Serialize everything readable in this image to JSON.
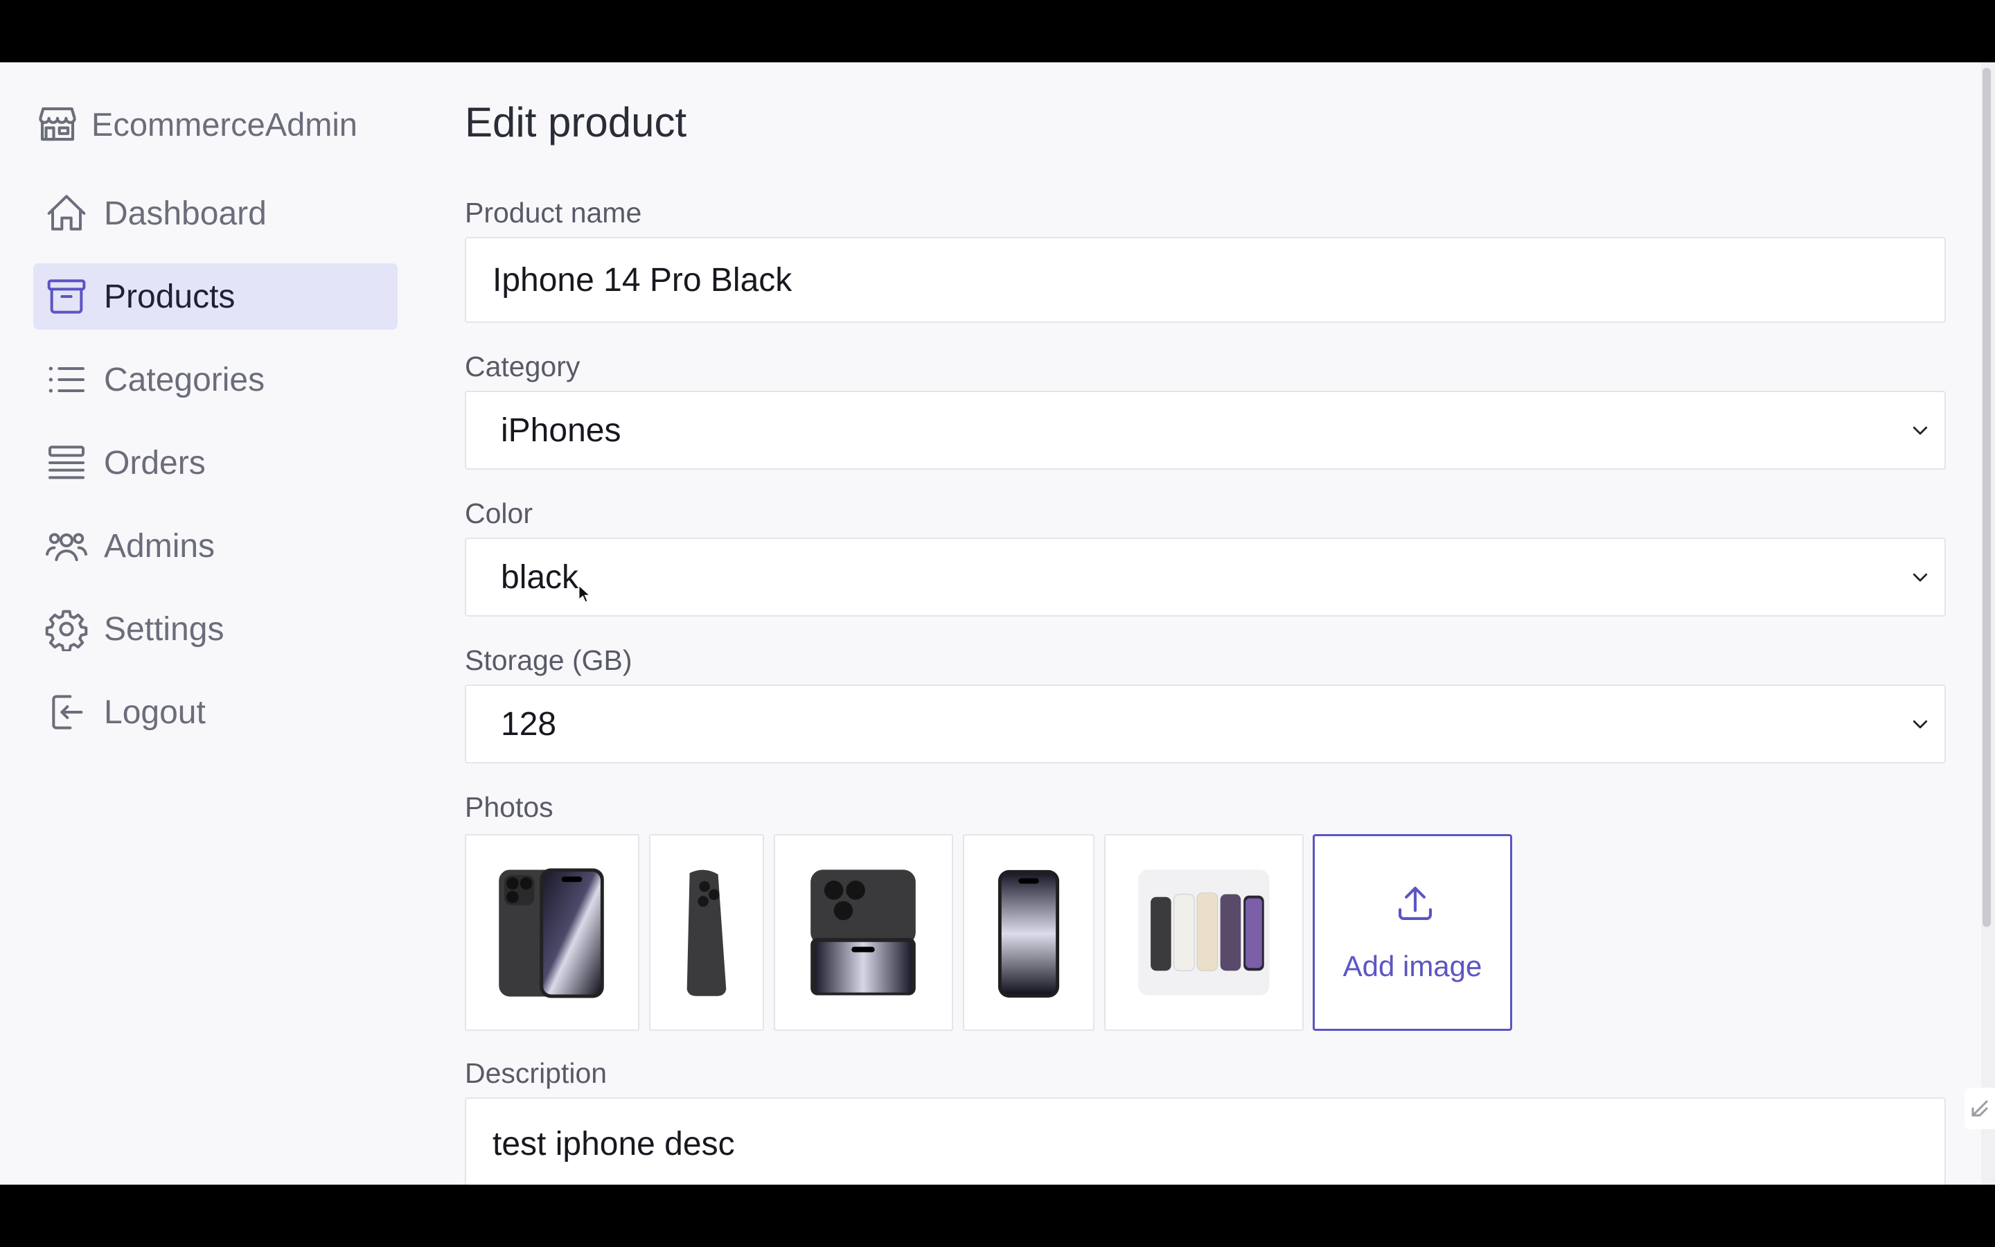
{
  "sidebar": {
    "logo": {
      "icon": "storefront-icon",
      "label": "EcommerceAdmin"
    },
    "items": [
      {
        "label": "Dashboard",
        "icon": "home-icon",
        "active": false
      },
      {
        "label": "Products",
        "icon": "archive-box-icon",
        "active": true
      },
      {
        "label": "Categories",
        "icon": "list-icon",
        "active": false
      },
      {
        "label": "Orders",
        "icon": "queue-list-icon",
        "active": false
      },
      {
        "label": "Admins",
        "icon": "users-icon",
        "active": false
      },
      {
        "label": "Settings",
        "icon": "gear-icon",
        "active": false
      },
      {
        "label": "Logout",
        "icon": "logout-icon",
        "active": false
      }
    ]
  },
  "main": {
    "title": "Edit product",
    "product_name": {
      "label": "Product name",
      "value": "Iphone 14 Pro Black"
    },
    "category": {
      "label": "Category",
      "value": "iPhones"
    },
    "color": {
      "label": "Color",
      "value": "black"
    },
    "storage": {
      "label": "Storage (GB)",
      "value": "128"
    },
    "photos": {
      "label": "Photos",
      "items": [
        "iphone-front-back-photo",
        "iphone-side-photo",
        "iphone-box-photo",
        "iphone-front-photo",
        "iphone-colors-photo"
      ],
      "add_label": "Add image"
    },
    "description": {
      "label": "Description",
      "value": "test iphone desc"
    }
  },
  "colors": {
    "accent": "#5b55c3",
    "active_nav_bg": "#e4e4f8",
    "page_bg": "#f8f8fb"
  }
}
